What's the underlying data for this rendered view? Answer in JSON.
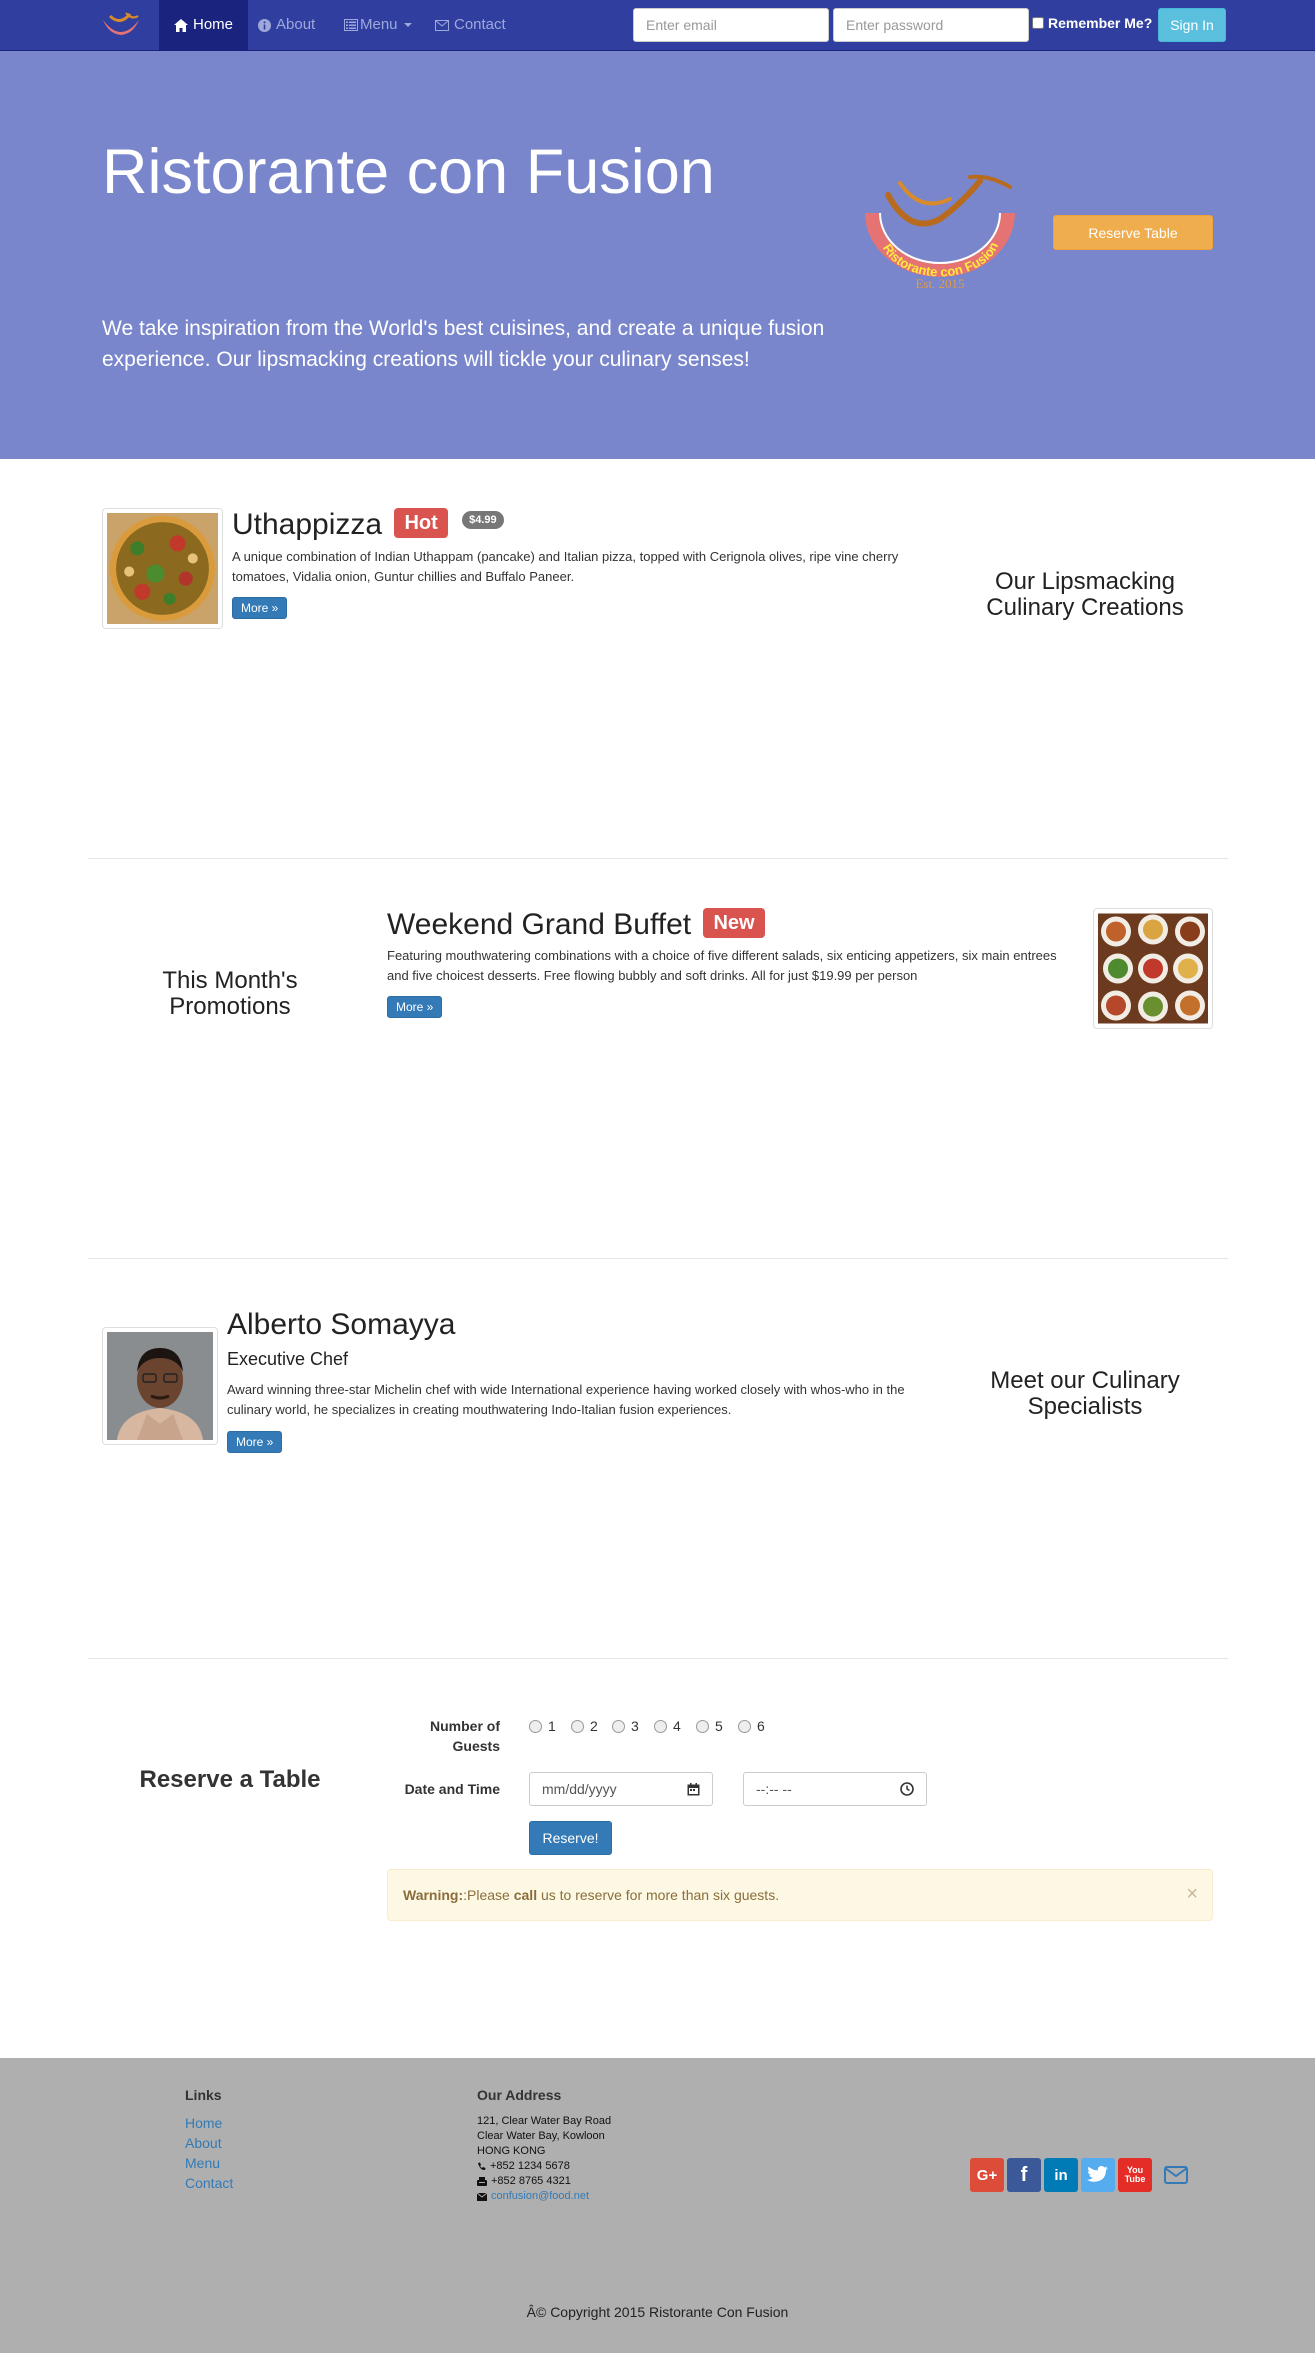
{
  "nav": {
    "home": "Home",
    "about": "About",
    "menu": "Menu",
    "contact": "Contact",
    "email_placeholder": "Enter email",
    "password_placeholder": "Enter password",
    "remember": "Remember Me?",
    "signin": "Sign In"
  },
  "jumbotron": {
    "title": "Ristorante con Fusion",
    "text": "We take inspiration from the World's best cuisines, and create a unique fusion experience. Our lipsmacking creations will tickle your culinary senses!",
    "reserve_button": "Reserve Table",
    "logo_text": "Ristorante con Fusion",
    "logo_est": "Est. 2015"
  },
  "dish": {
    "name": "Uthappizza",
    "label": "Hot",
    "price": "$4.99",
    "description": "A unique combination of Indian Uthappam (pancake) and Italian pizza, topped with Cerignola olives, ripe vine cherry tomatoes, Vidalia onion, Guntur chillies and Buffalo Paneer.",
    "more": "More »",
    "side": "Our Lipsmacking Culinary Creations"
  },
  "promotion": {
    "name": "Weekend Grand Buffet",
    "label": "New",
    "description": "Featuring mouthwatering combinations with a choice of five different salads, six enticing appetizers, six main entrees and five choicest desserts. Free flowing bubbly and soft drinks. All for just $19.99 per person",
    "more": "More »",
    "side": "This Month's Promotions"
  },
  "leader": {
    "name": "Alberto Somayya",
    "designation": "Executive Chef",
    "description": "Award winning three-star Michelin chef with wide International experience having worked closely with whos-who in the culinary world, he specializes in creating mouthwatering Indo-Italian fusion experiences.",
    "more": "More »",
    "side": "Meet our Culinary Specialists"
  },
  "reserve": {
    "heading": "Reserve a Table",
    "guests_label": "Number of Guests",
    "guest_options": [
      "1",
      "2",
      "3",
      "4",
      "5",
      "6"
    ],
    "datetime_label": "Date and Time",
    "date_placeholder": "mm/dd/yyyy",
    "time_placeholder": "--:-- --",
    "submit": "Reserve!",
    "warning_strong": "Warning:",
    "warning_pre": ":Please ",
    "warning_call": "call",
    "warning_post": " us to reserve for more than six guests.",
    "close": "×"
  },
  "footer": {
    "links_heading": "Links",
    "links": [
      "Home",
      "About",
      "Menu",
      "Contact"
    ],
    "address_heading": "Our Address",
    "address": [
      "121, Clear Water Bay Road",
      "Clear Water Bay, Kowloon",
      "HONG KONG"
    ],
    "phone": "+852 1234 5678",
    "fax": "+852 8765 4321",
    "email": "confusion@food.net",
    "social": [
      "G+",
      "f",
      "in",
      "t",
      "You Tube"
    ],
    "copyright": "Â© Copyright 2015 Ristorante Con Fusion"
  },
  "colors": {
    "nav": "#303f9f",
    "nav_active": "#1a237e",
    "jumbotron": "#7986cb",
    "footer": "#afafaf",
    "google": "#dd4b39",
    "facebook": "#3b5998",
    "linkedin": "#007bb6",
    "twitter": "#55acee",
    "youtube": "#e52d27"
  }
}
